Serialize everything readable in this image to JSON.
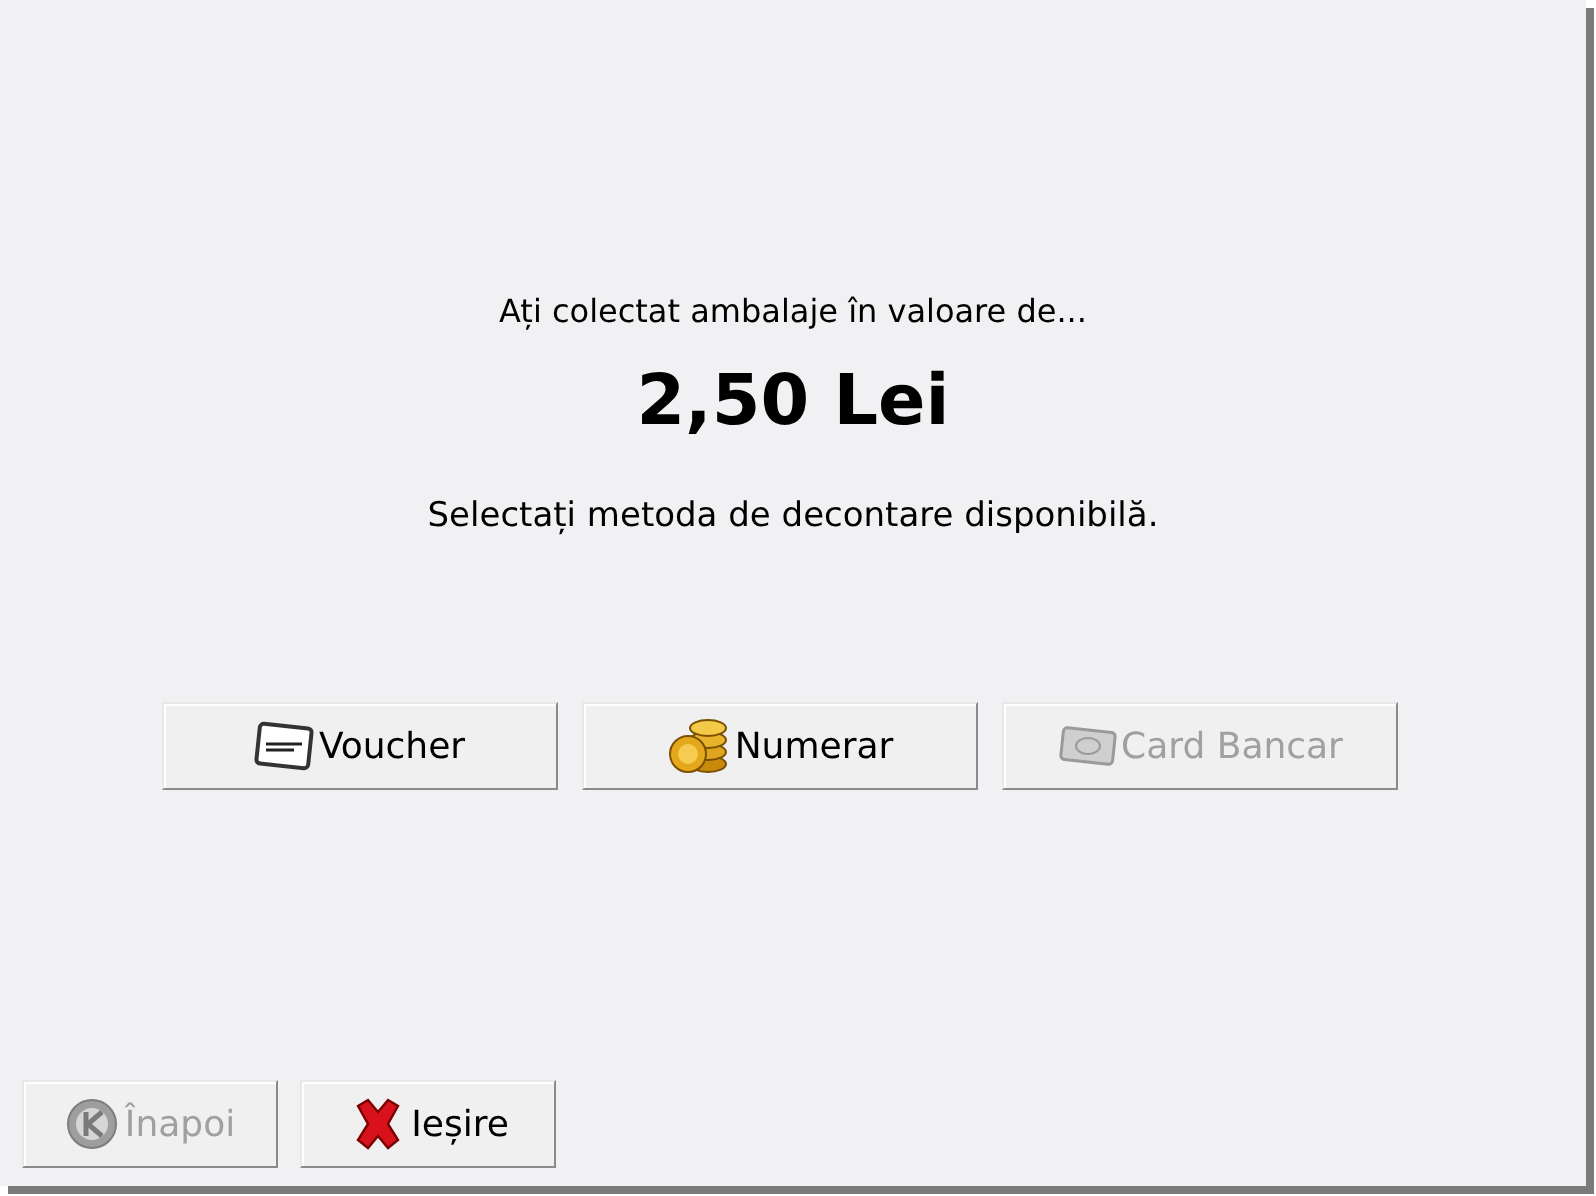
{
  "message": {
    "intro": "Ați colectat ambalaje în valoare de...",
    "amount": "2,50 Lei",
    "instruction": "Selectați metoda de decontare disponibilă."
  },
  "payment_methods": [
    {
      "label": "Voucher",
      "kind": "voucher",
      "disabled": false
    },
    {
      "label": "Numerar",
      "kind": "cash",
      "disabled": false
    },
    {
      "label": "Card Bancar",
      "kind": "card",
      "disabled": true
    }
  ],
  "footer_buttons": [
    {
      "label": "Înapoi",
      "kind": "back",
      "disabled": true
    },
    {
      "label": "Ieșire",
      "kind": "exit",
      "disabled": false
    }
  ]
}
